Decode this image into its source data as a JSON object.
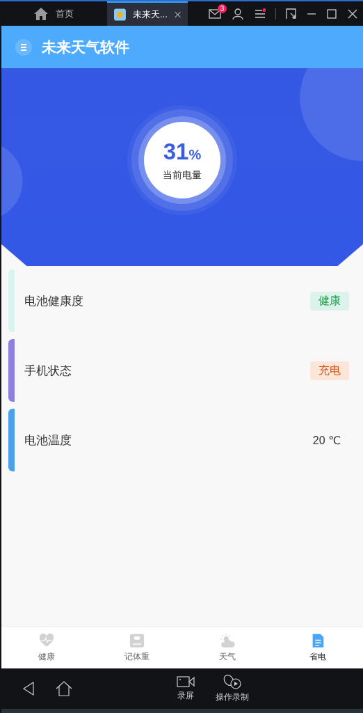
{
  "emulator": {
    "tabs": [
      {
        "kind": "home",
        "label": "首页",
        "selected": false
      },
      {
        "kind": "app",
        "label": "未来天...",
        "selected": true
      }
    ],
    "mail_badge": "3"
  },
  "app_bar": {
    "title": "未来天气软件"
  },
  "battery": {
    "percent": "31",
    "unit": "%",
    "label": "当前电量"
  },
  "items": [
    {
      "label": "电池健康度",
      "value": "健康",
      "kind": "good-tag",
      "color": "#d9f3ee"
    },
    {
      "label": "手机状态",
      "value": "充电",
      "kind": "warn-tag",
      "color": "#8f7fe0"
    },
    {
      "label": "电池温度",
      "value": "20 ℃",
      "kind": "plain",
      "color": "#4fa0ea"
    }
  ],
  "nav": [
    {
      "kind": "heart",
      "label": "健康",
      "selected": false
    },
    {
      "kind": "scale",
      "label": "记体重",
      "selected": false
    },
    {
      "kind": "weather",
      "label": "天气",
      "selected": false
    },
    {
      "kind": "doc",
      "label": "省电",
      "selected": true
    }
  ],
  "system_bar": {
    "buttons": [
      {
        "kind": "record",
        "label": "录屏"
      },
      {
        "kind": "macro",
        "label": "操作录制"
      }
    ]
  }
}
